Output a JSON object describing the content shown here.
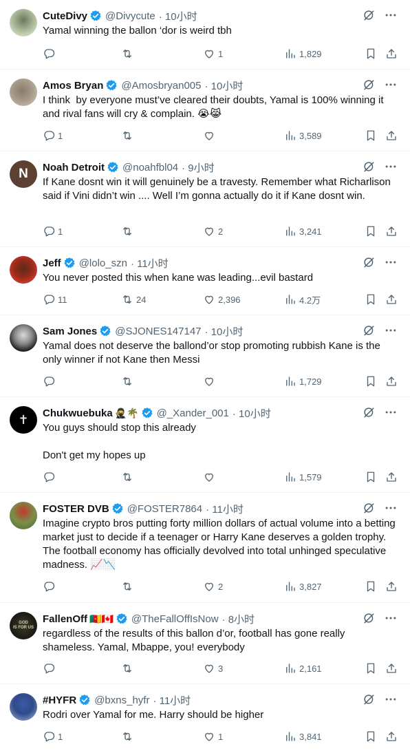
{
  "colors": {
    "verified": "#1d9bf0",
    "muted": "#536471",
    "text": "#0f1419"
  },
  "tweets": [
    {
      "name": "CuteDivy",
      "handle": "@Divycute",
      "time": "· 10小时",
      "text": "Yamal winning the ballon ‘dor is weird tbh",
      "reply": "",
      "retweet": "",
      "like": "1",
      "views": "1,829",
      "avatar_icon": "avatar-photo-icon"
    },
    {
      "name": "Amos Bryan",
      "handle": "@Amosbryan005",
      "time": "· 10小时",
      "text": "I think  by everyone must’ve cleared their doubts, Yamal is 100% winning it and rival fans will cry & complain. 😭😹",
      "reply": "1",
      "retweet": "",
      "like": "",
      "views": "3,589",
      "avatar_icon": "avatar-photo-icon"
    },
    {
      "name": "Noah Detroit",
      "handle": "@noahfbl04",
      "time": "· 9小时",
      "text": "If Kane dosnt win it will genuinely be a travesty. Remember what Richarlison said if Vini didn’t win .... Well I’m gonna actually do it if Kane dosnt win.",
      "reply": "1",
      "retweet": "",
      "like": "2",
      "views": "3,241",
      "avatar_letter": "N"
    },
    {
      "name": "Jeff",
      "handle": "@lolo_szn",
      "time": "· 11小时",
      "text": "You never posted this when kane was leading...evil bastard",
      "reply": "11",
      "retweet": "24",
      "like": "2,396",
      "views": "4.2万",
      "avatar_icon": "avatar-photo-icon"
    },
    {
      "name": "Sam Jones",
      "handle": "@SJONES147147",
      "time": "· 10小时",
      "text": "Yamal does not deserve the ballond’or stop promoting rubbish Kane is the only winner if not Kane then Messi",
      "reply": "",
      "retweet": "",
      "like": "",
      "views": "1,729",
      "avatar_icon": "avatar-photo-icon"
    },
    {
      "name": "Chukwuebuka",
      "name_emoji": "🥷🌴",
      "handle": "@_Xander_001",
      "time": "· 10小时",
      "text": "You guys should stop this already\n\nDon't get my hopes up",
      "reply": "",
      "retweet": "",
      "like": "",
      "views": "1,579",
      "avatar_icon": "avatar-photo-icon"
    },
    {
      "name": "FOSTER DVB",
      "handle": "@FOSTER7864",
      "time": "· 11小时",
      "text": "Imagine crypto bros putting forty million dollars of actual volume into a betting market just to decide if a teenager or Harry Kane deserves a golden trophy. The football economy has officially devolved into total unhinged speculative madness. 📈📉",
      "reply": "",
      "retweet": "",
      "like": "2",
      "views": "3,827",
      "avatar_icon": "avatar-photo-icon"
    },
    {
      "name": "FallenOff",
      "name_emoji": "🇨🇲🇨🇦",
      "handle": "@TheFallOffIsNow",
      "time": "· 8小时",
      "text": "regardless of the results of this ballon d’or, football has gone really shameless. Yamal, Mbappe, you! everybody",
      "reply": "",
      "retweet": "",
      "like": "3",
      "views": "2,161",
      "avatar_icon": "avatar-photo-icon"
    },
    {
      "name": "#HYFR",
      "handle": "@bxns_hyfr",
      "time": "· 11小时",
      "text": "Rodri over Yamal for me. Harry should be higher",
      "reply": "1",
      "retweet": "",
      "like": "1",
      "views": "3,841",
      "avatar_icon": "avatar-photo-icon"
    }
  ]
}
